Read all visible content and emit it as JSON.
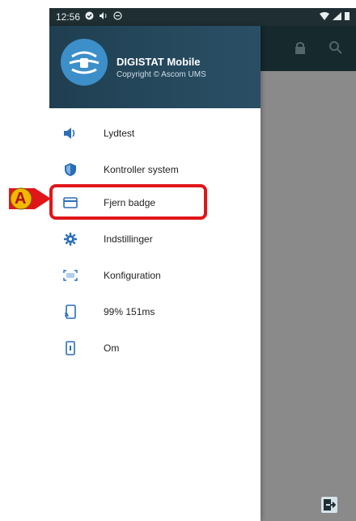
{
  "statusbar": {
    "time": "12:56"
  },
  "header": {
    "app_name": "DIGISTAT Mobile",
    "copyright": "Copyright © Ascom UMS"
  },
  "menu": {
    "items": [
      {
        "label": "Lydtest",
        "icon": "speaker-icon"
      },
      {
        "label": "Kontroller system",
        "icon": "shield-icon"
      },
      {
        "label": "Fjern badge",
        "icon": "card-icon"
      },
      {
        "label": "Indstillinger",
        "icon": "gear-icon"
      },
      {
        "label": "Konfiguration",
        "icon": "barcode-scan-icon"
      },
      {
        "label": "99% 151ms",
        "icon": "cast-signal-icon"
      },
      {
        "label": "Om",
        "icon": "phone-info-icon"
      }
    ]
  },
  "callout": {
    "label": "A",
    "color": "#f2b800"
  },
  "colors": {
    "accent": "#2a6db8",
    "highlight": "#e0161a",
    "header": "#24465a"
  }
}
